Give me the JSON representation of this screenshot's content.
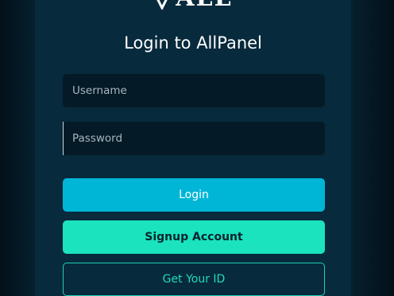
{
  "brand": {
    "logo_text": "ALL",
    "logo_icon": "diamond-icon"
  },
  "login_form": {
    "title": "Login to AllPanel",
    "username_placeholder": "Username",
    "password_placeholder": "Password",
    "login_label": "Login",
    "signup_label": "Signup Account",
    "get_id_label": "Get Your ID"
  },
  "colors": {
    "background": "#04131d",
    "card": "#072a3c",
    "input_bg": "#041b27",
    "login_button": "#00b6d6",
    "signup_button": "#1ae3bd",
    "get_id_border": "#1fd1b0"
  }
}
